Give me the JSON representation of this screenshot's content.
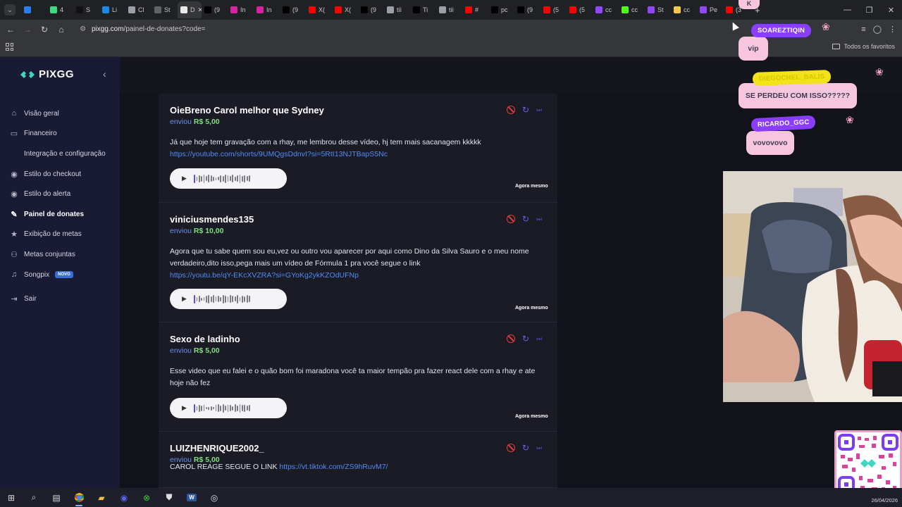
{
  "browser": {
    "tabs": [
      {
        "label": "",
        "color": "#2b7de9"
      },
      {
        "label": "4",
        "color": "#3ddc84"
      },
      {
        "label": "S",
        "color": "#111111"
      },
      {
        "label": "Li",
        "color": "#1e88e5"
      },
      {
        "label": "Cl",
        "color": "#9aa0a6"
      },
      {
        "label": "St",
        "color": "#5f6368"
      },
      {
        "label": "D",
        "color": "#e8e8e8"
      },
      {
        "label": "(9",
        "color": "#000000"
      },
      {
        "label": "In",
        "color": "#d6249f"
      },
      {
        "label": "In",
        "color": "#d6249f"
      },
      {
        "label": "(9",
        "color": "#000000"
      },
      {
        "label": "X(",
        "color": "#ff0000"
      },
      {
        "label": "X(",
        "color": "#ff0000"
      },
      {
        "label": "(9",
        "color": "#000000"
      },
      {
        "label": "tiì",
        "color": "#9aa0a6"
      },
      {
        "label": "Ti",
        "color": "#000000"
      },
      {
        "label": "tiì",
        "color": "#9aa0a6"
      },
      {
        "label": "#",
        "color": "#ff0000"
      },
      {
        "label": "pc",
        "color": "#000000"
      },
      {
        "label": "(9",
        "color": "#000000"
      },
      {
        "label": "(5",
        "color": "#ff0000"
      },
      {
        "label": "(5",
        "color": "#ff0000"
      },
      {
        "label": "cc",
        "color": "#9146ff"
      },
      {
        "label": "cc",
        "color": "#53fc18"
      },
      {
        "label": "St",
        "color": "#9146ff"
      },
      {
        "label": "cc",
        "color": "#f2c94c"
      },
      {
        "label": "Pe",
        "color": "#9146ff"
      },
      {
        "label": "(3",
        "color": "#ff0000"
      }
    ],
    "active_tab_index": 6,
    "new_tab": "+",
    "url_host": "pixgg.com",
    "url_path": "/painel-de-donates?code=",
    "all_favorites": "Todos os favoritos"
  },
  "sidebar": {
    "logo": "PIXGG",
    "items": [
      {
        "label": "Visão geral",
        "icon": "home-icon",
        "glyph": "⌂"
      },
      {
        "label": "Financeiro",
        "icon": "wallet-icon",
        "glyph": "▭"
      },
      {
        "label": "Integração e configuração",
        "icon": "settings-icon",
        "glyph": ""
      },
      {
        "label": "Estilo do checkout",
        "icon": "palette-icon",
        "glyph": "◉"
      },
      {
        "label": "Estilo do alerta",
        "icon": "palette-icon",
        "glyph": "◉"
      },
      {
        "label": "Painel de donates",
        "icon": "brush-icon",
        "glyph": "✎",
        "selected": true
      },
      {
        "label": "Exibição de metas",
        "icon": "star-icon",
        "glyph": "★"
      },
      {
        "label": "Metas conjuntas",
        "icon": "users-icon",
        "glyph": "⚇"
      },
      {
        "label": "Songpix",
        "icon": "music-icon",
        "glyph": "♫",
        "badge": "NOVO"
      },
      {
        "label": "Sair",
        "icon": "logout-icon",
        "glyph": "⇥"
      }
    ]
  },
  "donates": [
    {
      "name": "OieBreno Carol melhor que Sydney",
      "sent": "enviou",
      "amount": "R$ 5,00",
      "text": "Já que hoje tem gravação com a rhay, me lembrou desse vídeo, hj tem mais sacanagem kkkkk",
      "link": "https://youtube.com/shorts/9UMQgsDdnvI?si=5RtI13NJTBapS5Nc",
      "time": "Agora mesmo"
    },
    {
      "name": "viniciusmendes135",
      "sent": "enviou",
      "amount": "R$ 10,00",
      "text": "Agora que tu sabe quem sou eu,vez ou outro vou aparecer por aqui como Dino da Silva Sauro e o meu nome verdadeiro,dito isso,pega mais um vídeo de Fórmula 1 pra você segue o link",
      "link": "https://youtu.be/qY-EKcXVZRA?si=GYoKg2ykKZOdUFNp",
      "time": "Agora mesmo"
    },
    {
      "name": "Sexo de ladinho",
      "sent": "enviou",
      "amount": "R$ 5,00",
      "text": "Esse video que eu falei e o quão bom foi maradona você ta maior tempão pra fazer react dele com a rhay e ate hoje não fez",
      "link": "",
      "time": "Agora mesmo"
    },
    {
      "name": "LUIZHENRIQUE2002_",
      "sent": "enviou",
      "amount": "R$ 5,00",
      "text": "CAROL REAGE SEGUE O LINK",
      "link": "https://vt.tiktok.com/ZS9hRuvM7/",
      "time": ""
    }
  ],
  "overlay": {
    "chat": [
      {
        "user": "SOAREZTIQIN",
        "message": "vip",
        "user_color": "#8a3dfc"
      },
      {
        "user": "DIEGOCHEL_BALIS",
        "message": "SE PERDEU COM ISSO?????",
        "user_color": "#f2e21a"
      },
      {
        "user": "RICARDO_GGC",
        "message": "vovovovo",
        "user_color": "#8a3dfc"
      }
    ],
    "top_letter": "K"
  },
  "taskbar": {
    "date": "26/04/2026"
  }
}
